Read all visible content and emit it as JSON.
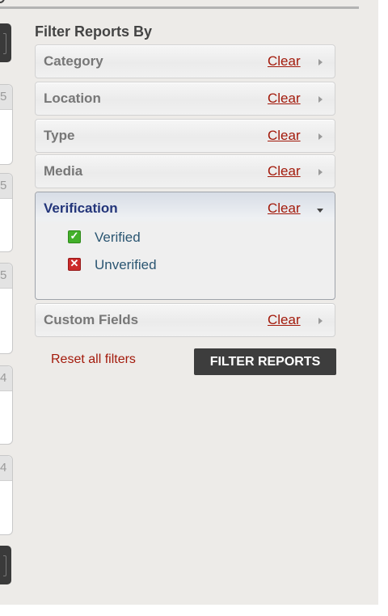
{
  "sidebar": {
    "title": "Filter Reports By",
    "stubs": [
      {
        "num": "5"
      },
      {
        "num": "5"
      },
      {
        "num": "5"
      },
      {
        "num": "4"
      },
      {
        "num": "4"
      }
    ],
    "filters": [
      {
        "name": "Category",
        "clear_label": "Clear",
        "state": "collapsed"
      },
      {
        "name": "Location",
        "clear_label": "Clear",
        "state": "collapsed"
      },
      {
        "name": "Type",
        "clear_label": "Clear",
        "state": "collapsed"
      },
      {
        "name": "Media",
        "clear_label": "Clear",
        "state": "collapsed"
      },
      {
        "name": "Verification",
        "clear_label": "Clear",
        "state": "expanded",
        "options": [
          {
            "label": "Verified",
            "icon": "check-icon",
            "color": "#43b02a"
          },
          {
            "label": "Unverified",
            "icon": "x-icon",
            "color": "#cc2a2a"
          }
        ]
      },
      {
        "name": "Custom Fields",
        "clear_label": "Clear",
        "state": "collapsed"
      }
    ],
    "reset_label": "Reset all filters",
    "submit_label": "FILTER REPORTS"
  },
  "colors": {
    "panel_bg": "#edebe8",
    "link_red": "#a31a0b",
    "heading_blue": "#23357a",
    "option_blue": "#2b5672",
    "button_dark": "#3d3d3d"
  }
}
